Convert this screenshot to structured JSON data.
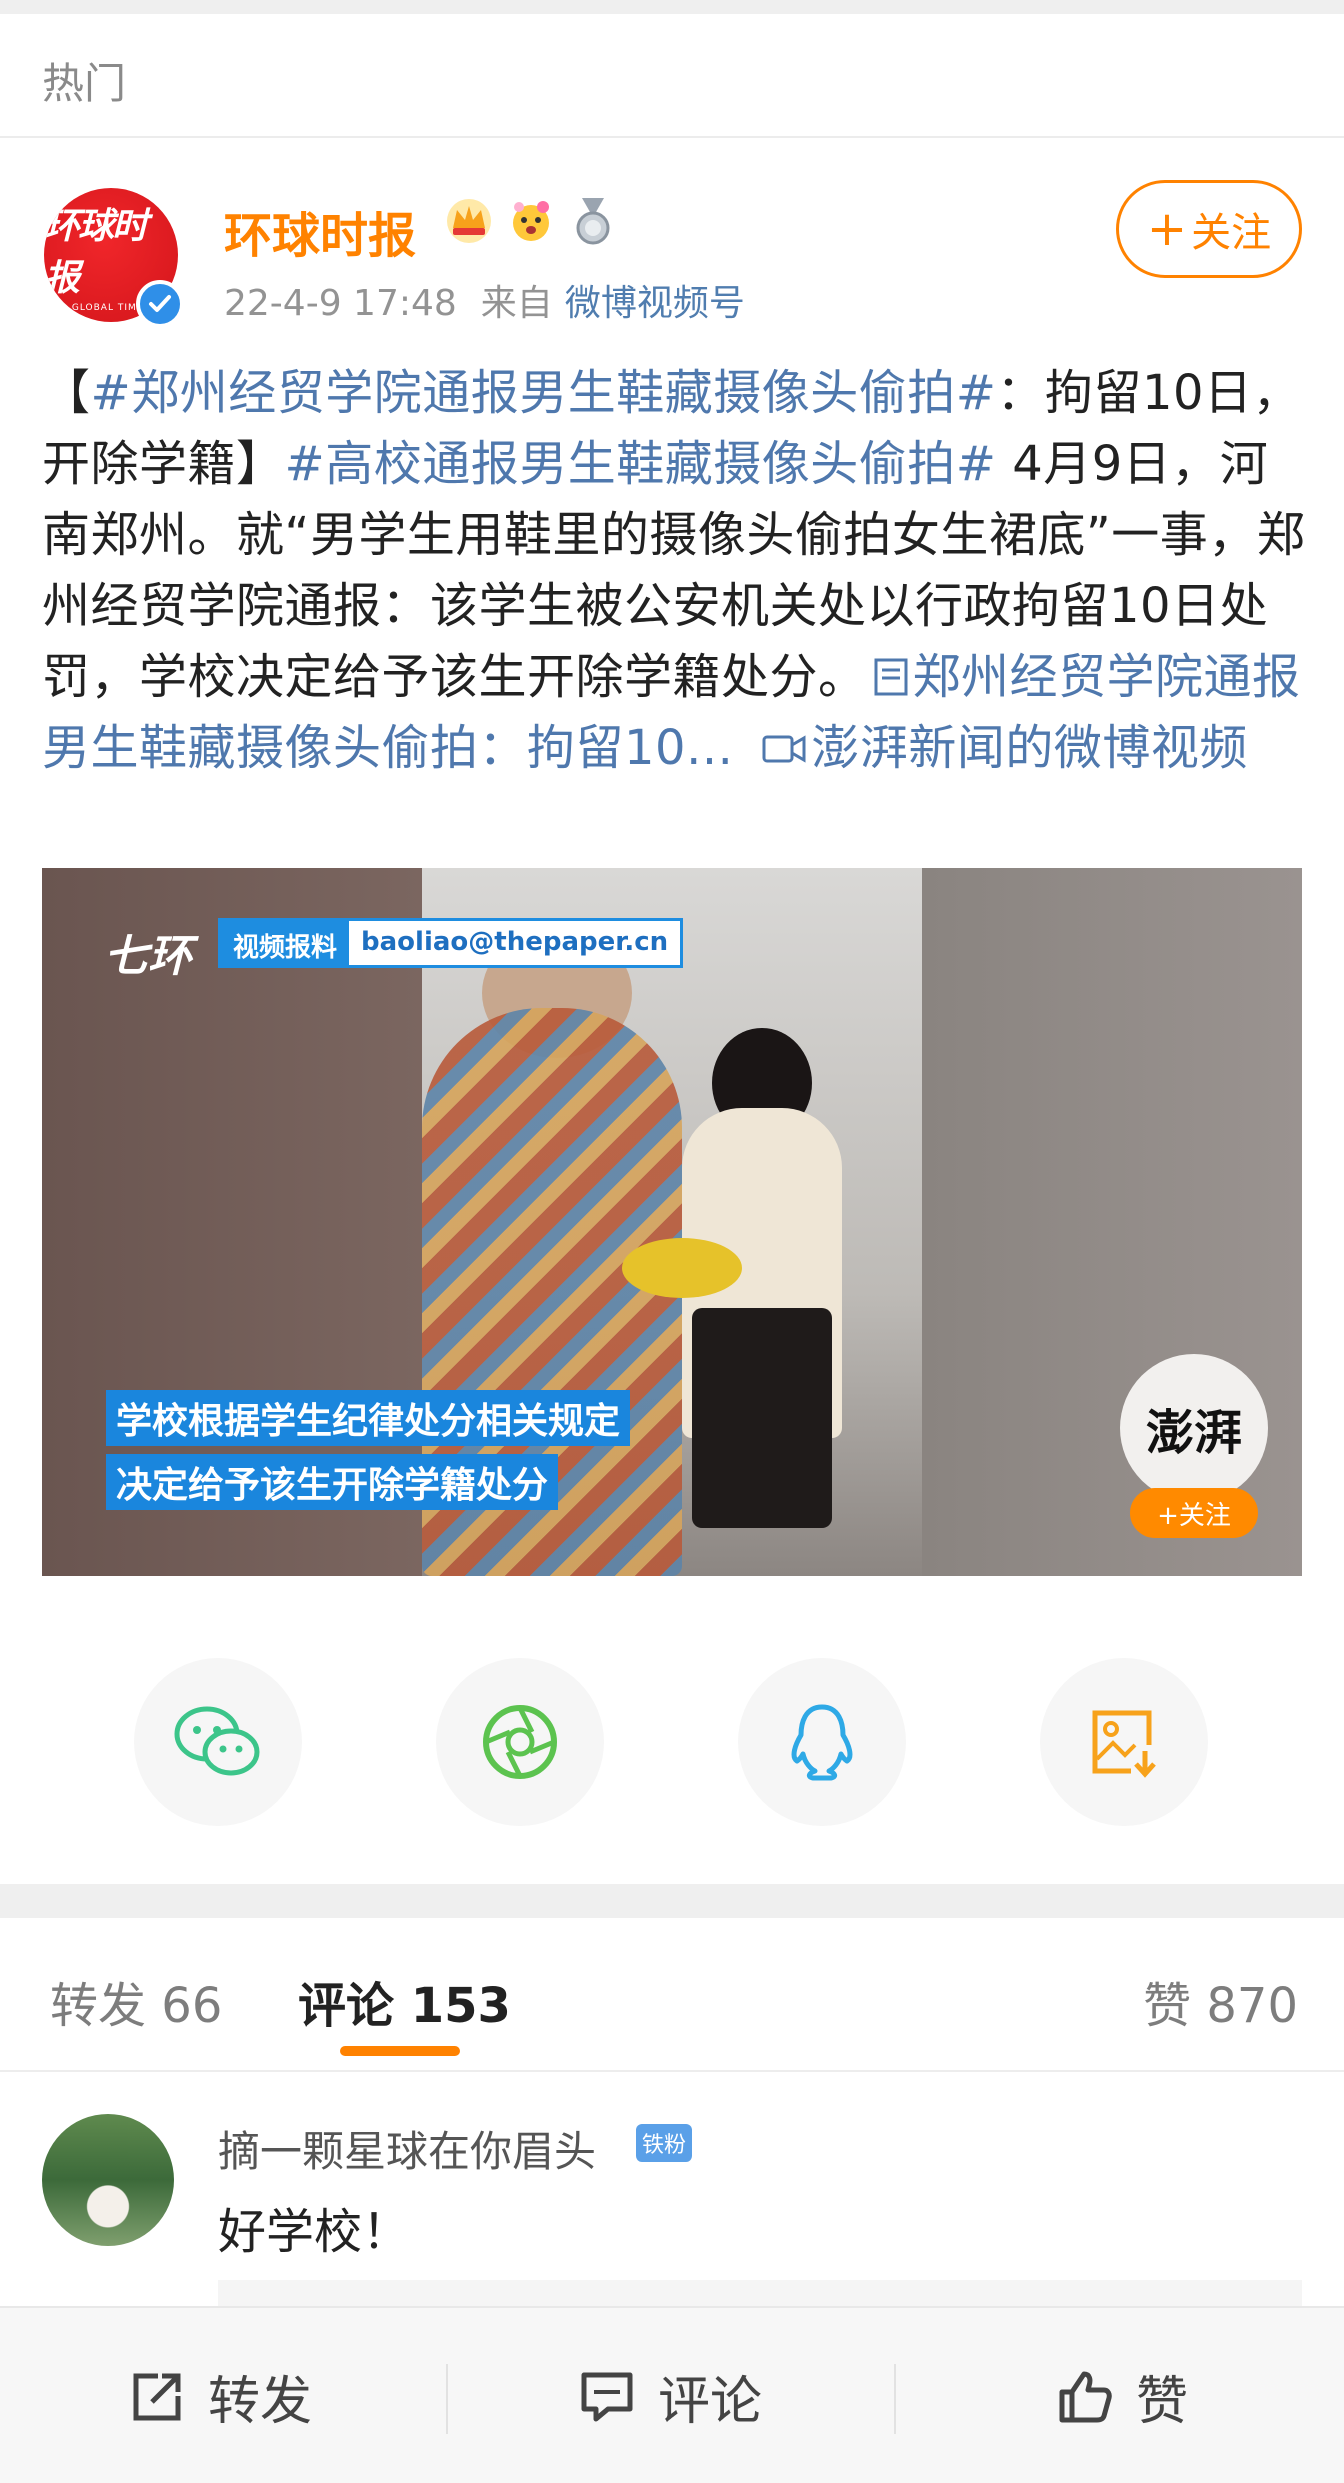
{
  "header": {
    "section_label": "热门"
  },
  "post": {
    "author": "环球时报",
    "avatar_text": "环球时报",
    "avatar_sub": "GLOBAL TIMES",
    "time": "22-4-9 17:48",
    "from_label": "来自",
    "source": "微博视频号",
    "follow_label": "关注",
    "follow_plus": "+",
    "text": {
      "open_bracket": "【",
      "tag1": "#郑州经贸学院通报男生鞋藏摄像头偷拍#",
      "part1": "：拘留10日，开除学籍】",
      "tag2": "#高校通报男生鞋藏摄像头偷拍#",
      "part2": " 4月9日，河南郑州。就“男学生用鞋里的摄像头偷拍女生裙底”一事，郑州经贸学院通报：该学生被公安机关处以行政拘留10日处罚，学校决定给予该生开除学籍处分。",
      "link1": "郑州经贸学院通报男生鞋藏摄像头偷拍：拘留10...",
      "link2": "澎湃新闻的微博视频"
    },
    "video": {
      "logo": "七环",
      "email_label": "视频报料",
      "email": "baoliao@thepaper.cn",
      "caption1": "学校根据学生纪律处分相关规定",
      "caption2": "决定给予该生开除学籍处分",
      "channel": "澎湃",
      "channel_follow": "+关注"
    }
  },
  "share": {
    "items": [
      "wechat-icon",
      "moments-icon",
      "qq-icon",
      "save-image-icon"
    ],
    "colors": {
      "wechat": "#3cc58a",
      "moments": "#5cc34f",
      "qq": "#2ea9e6",
      "save": "#f7a21b"
    }
  },
  "tabs": {
    "repost_label": "转发",
    "repost_count": "66",
    "comment_label": "评论",
    "comment_count": "153",
    "like_label": "赞",
    "like_count": "870"
  },
  "comment": {
    "user": "摘一颗星球在你眉头",
    "badge": "铁粉",
    "text": "好学校！"
  },
  "bottom_bar": {
    "repost": "转发",
    "comment": "评论",
    "like": "赞"
  },
  "colors": {
    "accent": "#ff8200",
    "link": "#4f78ad"
  }
}
